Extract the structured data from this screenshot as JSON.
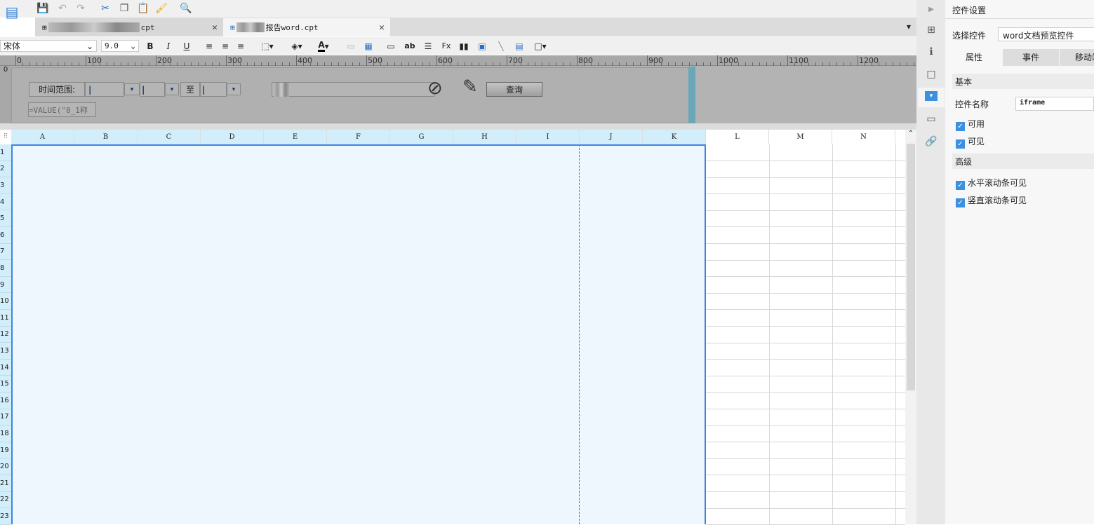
{
  "toolbar": {
    "icons": [
      "logo-icon",
      "save-icon",
      "undo-icon",
      "redo-icon",
      "cut-icon",
      "copy-icon",
      "paste-icon",
      "format-painter-icon",
      "preview-icon"
    ]
  },
  "tabs": [
    {
      "label": "cpt",
      "active": false
    },
    {
      "label": "报告word.cpt",
      "active": true
    }
  ],
  "format": {
    "font": "宋体",
    "size": "9.0",
    "bold": "B",
    "italic": "I",
    "underline": "U",
    "text_color_label": "A"
  },
  "ruler": {
    "labels": [
      "0",
      "100",
      "200",
      "300",
      "400",
      "500",
      "600",
      "700",
      "800",
      "900",
      "1000",
      "1100",
      "1200"
    ],
    "vertical_label": "0"
  },
  "form": {
    "time_range_label": "时间范围:",
    "to_label": "至",
    "query_button": "查询",
    "formula": "=VALUE(\"0_1称"
  },
  "grid": {
    "columns": [
      "A",
      "B",
      "C",
      "D",
      "E",
      "F",
      "G",
      "H",
      "I",
      "J",
      "K",
      "L",
      "M",
      "N"
    ],
    "rows": [
      "1",
      "2",
      "3",
      "4",
      "5",
      "6",
      "7",
      "8",
      "9",
      "10",
      "11",
      "12",
      "13",
      "14",
      "15",
      "16",
      "17",
      "18",
      "19",
      "20",
      "21",
      "22",
      "23"
    ]
  },
  "panel": {
    "title": "控件设置",
    "select_label": "选择控件",
    "select_value": "word文档预览控件",
    "tabs": [
      "属性",
      "事件",
      "移动端"
    ],
    "basic_section": "基本",
    "name_label": "控件名称",
    "name_value": "iframe",
    "enabled": "可用",
    "visible": "可见",
    "advanced_section": "高级",
    "hscroll": "水平滚动条可见",
    "vscroll": "竖直滚动条可见"
  },
  "colors": {
    "accent": "#3d86e0",
    "selection_fill": "#eef6fe",
    "header_fill": "#d2eefa"
  }
}
